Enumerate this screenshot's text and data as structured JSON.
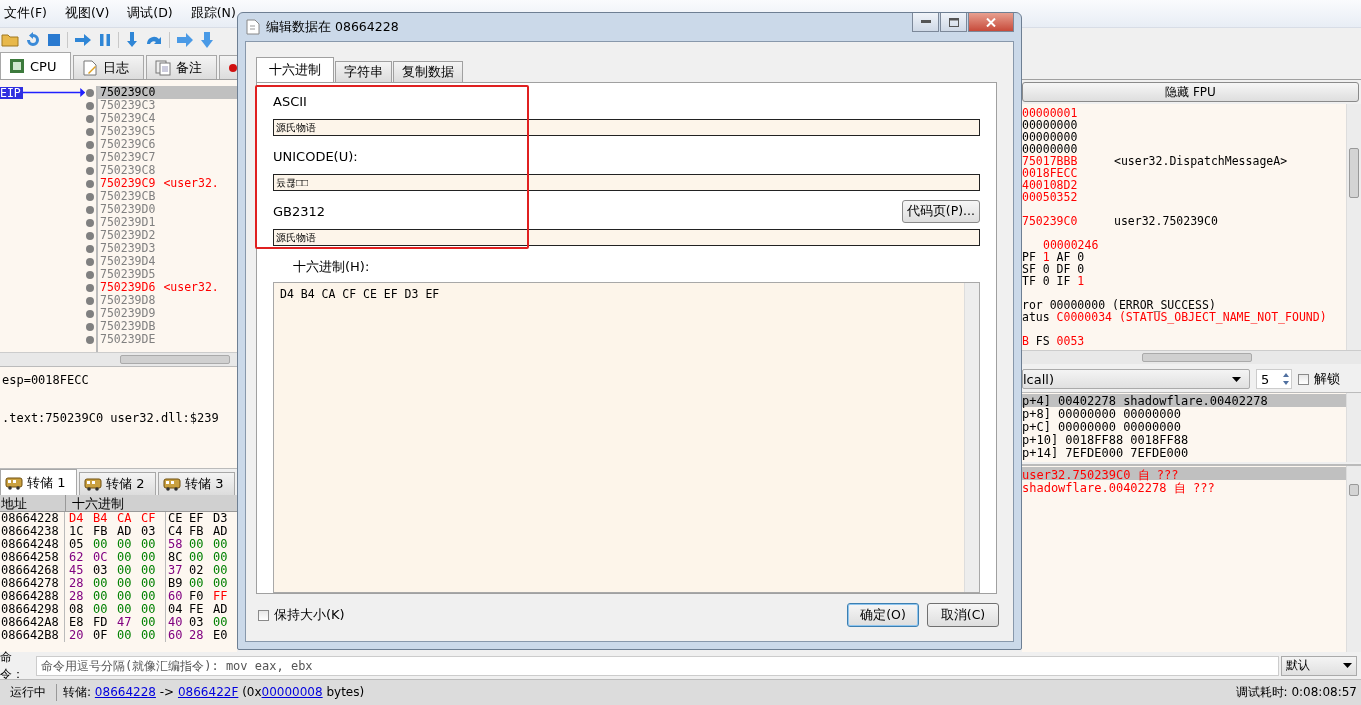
{
  "menu": [
    "文件(F)",
    "视图(V)",
    "调试(D)",
    "跟踪(N)"
  ],
  "main_tabs": [
    {
      "label": "CPU",
      "selected": true
    },
    {
      "label": "日志",
      "selected": false
    },
    {
      "label": "备注",
      "selected": false
    },
    {
      "selected": false
    }
  ],
  "disassembly": {
    "eip_label": "EIP",
    "rows": [
      {
        "address": "750239C0",
        "kind": "plain",
        "selected": true
      },
      {
        "address": "750239C3",
        "kind": "plain",
        "selected": false
      },
      {
        "address": "750239C4",
        "kind": "plain",
        "selected": false
      },
      {
        "address": "750239C5",
        "kind": "plain",
        "selected": false
      },
      {
        "address": "750239C6",
        "kind": "plain",
        "selected": false
      },
      {
        "address": "750239C7",
        "kind": "plain",
        "selected": false
      },
      {
        "address": "750239C8",
        "kind": "plain",
        "selected": false
      },
      {
        "address": "750239C9",
        "comment": "<user32.",
        "kind": "reference",
        "selected": false
      },
      {
        "address": "750239CB",
        "kind": "plain",
        "selected": false
      },
      {
        "address": "750239D0",
        "kind": "plain",
        "selected": false
      },
      {
        "address": "750239D1",
        "kind": "plain",
        "selected": false
      },
      {
        "address": "750239D2",
        "kind": "plain",
        "selected": false
      },
      {
        "address": "750239D3",
        "kind": "plain",
        "selected": false
      },
      {
        "address": "750239D4",
        "kind": "plain",
        "selected": false
      },
      {
        "address": "750239D5",
        "kind": "plain",
        "selected": false
      },
      {
        "address": "750239D6",
        "comment": "<user32.",
        "kind": "reference",
        "selected": false
      },
      {
        "address": "750239D8",
        "kind": "plain",
        "selected": false
      },
      {
        "address": "750239D9",
        "kind": "plain",
        "selected": false
      },
      {
        "address": "750239DB",
        "kind": "plain",
        "selected": false
      },
      {
        "address": "750239DE",
        "kind": "plain",
        "selected": false
      }
    ]
  },
  "info": [
    "esp=0018FECC",
    ".text:750239C0 user32.dll:$239"
  ],
  "dump_tabs": [
    {
      "label": "转储 1",
      "selected": true
    },
    {
      "label": "转储 2",
      "selected": false
    },
    {
      "label": "转储 3",
      "selected": false
    }
  ],
  "dump": {
    "columns": [
      "地址",
      "十六进制"
    ],
    "rows": [
      {
        "address": "08664228",
        "bytes": [
          {
            "text": "D4",
            "color": "#ff0000"
          },
          {
            "text": "B4",
            "color": "#ff0000"
          },
          {
            "text": "CA",
            "color": "#ff0000"
          },
          {
            "text": "CF",
            "color": "#ff0000"
          },
          {
            "text": "CE",
            "color": "#000000"
          },
          {
            "text": "EF",
            "color": "#000000"
          },
          {
            "text": "D3",
            "color": "#000000"
          }
        ]
      },
      {
        "address": "08664238",
        "bytes": [
          {
            "text": "1C",
            "color": "#000000"
          },
          {
            "text": "FB",
            "color": "#000000"
          },
          {
            "text": "AD",
            "color": "#000000"
          },
          {
            "text": "03",
            "color": "#000000"
          },
          {
            "text": "C4",
            "color": "#000000"
          },
          {
            "text": "FB",
            "color": "#000000"
          },
          {
            "text": "AD",
            "color": "#000000"
          }
        ]
      },
      {
        "address": "08664248",
        "bytes": [
          {
            "text": "05",
            "color": "#000000"
          },
          {
            "text": "00",
            "color": "#008000"
          },
          {
            "text": "00",
            "color": "#008000"
          },
          {
            "text": "00",
            "color": "#008000"
          },
          {
            "text": "58",
            "color": "#800080"
          },
          {
            "text": "00",
            "color": "#008000"
          },
          {
            "text": "00",
            "color": "#008000"
          }
        ]
      },
      {
        "address": "08664258",
        "bytes": [
          {
            "text": "62",
            "color": "#800080"
          },
          {
            "text": "0C",
            "color": "#800080"
          },
          {
            "text": "00",
            "color": "#008000"
          },
          {
            "text": "00",
            "color": "#008000"
          },
          {
            "text": "8C",
            "color": "#000000"
          },
          {
            "text": "00",
            "color": "#008000"
          },
          {
            "text": "00",
            "color": "#008000"
          }
        ]
      },
      {
        "address": "08664268",
        "bytes": [
          {
            "text": "45",
            "color": "#800080"
          },
          {
            "text": "03",
            "color": "#000000"
          },
          {
            "text": "00",
            "color": "#008000"
          },
          {
            "text": "00",
            "color": "#008000"
          },
          {
            "text": "37",
            "color": "#800080"
          },
          {
            "text": "02",
            "color": "#000000"
          },
          {
            "text": "00",
            "color": "#008000"
          }
        ]
      },
      {
        "address": "08664278",
        "bytes": [
          {
            "text": "28",
            "color": "#800080"
          },
          {
            "text": "00",
            "color": "#008000"
          },
          {
            "text": "00",
            "color": "#008000"
          },
          {
            "text": "00",
            "color": "#008000"
          },
          {
            "text": "B9",
            "color": "#000000"
          },
          {
            "text": "00",
            "color": "#008000"
          },
          {
            "text": "00",
            "color": "#008000"
          }
        ]
      },
      {
        "address": "08664288",
        "bytes": [
          {
            "text": "28",
            "color": "#800080"
          },
          {
            "text": "00",
            "color": "#008000"
          },
          {
            "text": "00",
            "color": "#008000"
          },
          {
            "text": "00",
            "color": "#008000"
          },
          {
            "text": "60",
            "color": "#800080"
          },
          {
            "text": "F0",
            "color": "#000000"
          },
          {
            "text": "FF",
            "color": "#ff0000"
          }
        ]
      },
      {
        "address": "08664298",
        "bytes": [
          {
            "text": "08",
            "color": "#000000"
          },
          {
            "text": "00",
            "color": "#008000"
          },
          {
            "text": "00",
            "color": "#008000"
          },
          {
            "text": "00",
            "color": "#008000"
          },
          {
            "text": "04",
            "color": "#000000"
          },
          {
            "text": "FE",
            "color": "#000000"
          },
          {
            "text": "AD",
            "color": "#000000"
          }
        ]
      },
      {
        "address": "086642A8",
        "bytes": [
          {
            "text": "E8",
            "color": "#000000"
          },
          {
            "text": "FD",
            "color": "#000000"
          },
          {
            "text": "47",
            "color": "#800080"
          },
          {
            "text": "00",
            "color": "#008000"
          },
          {
            "text": "40",
            "color": "#800080"
          },
          {
            "text": "03",
            "color": "#000000"
          },
          {
            "text": "00",
            "color": "#008000"
          }
        ]
      },
      {
        "address": "086642B8",
        "bytes": [
          {
            "text": "20",
            "color": "#800080"
          },
          {
            "text": "0F",
            "color": "#000000"
          },
          {
            "text": "00",
            "color": "#008000"
          },
          {
            "text": "00",
            "color": "#008000"
          },
          {
            "text": "60",
            "color": "#800080"
          },
          {
            "text": "28",
            "color": "#800080"
          },
          {
            "text": "E0",
            "color": "#000000"
          }
        ]
      }
    ]
  },
  "fpu_button": "隐藏 FPU",
  "registers": [
    [
      {
        "kind": "register",
        "segments": [
          {
            "text": "00000001",
            "changed": true
          }
        ]
      },
      {
        "kind": "register",
        "segments": [
          {
            "text": "00000000",
            "changed": false
          }
        ]
      },
      {
        "kind": "register",
        "segments": [
          {
            "text": "00000000",
            "changed": false
          }
        ]
      },
      {
        "kind": "register",
        "segments": [
          {
            "text": "00000000",
            "changed": false
          }
        ]
      },
      {
        "kind": "register",
        "segments": [
          {
            "text": "75017BBB",
            "changed": true
          },
          {
            "text": "<user32.DispatchMessageA>",
            "changed": false
          }
        ]
      },
      {
        "kind": "register",
        "segments": [
          {
            "text": "0018FECC",
            "changed": true
          }
        ]
      },
      {
        "kind": "register",
        "segments": [
          {
            "text": "400108D2",
            "changed": true
          }
        ]
      },
      {
        "kind": "register",
        "segments": [
          {
            "text": "00050352",
            "changed": true
          }
        ]
      }
    ],
    [
      {
        "kind": "register",
        "segments": [
          {
            "text": "750239C0",
            "changed": true
          },
          {
            "text": "user32.750239C0",
            "changed": false
          }
        ]
      }
    ],
    [
      {
        "kind": "indented",
        "segments": [
          {
            "text": "00000246",
            "changed": true
          }
        ]
      },
      {
        "kind": "flags",
        "segments": [
          {
            "text": "PF",
            "changed": false
          },
          {
            "text": "1",
            "changed": true
          },
          {
            "text": "AF",
            "changed": false
          },
          {
            "text": "0",
            "changed": false
          }
        ]
      },
      {
        "kind": "flags",
        "segments": [
          {
            "text": "SF",
            "changed": false
          },
          {
            "text": "0",
            "changed": false
          },
          {
            "text": "DF",
            "changed": false
          },
          {
            "text": "0",
            "changed": false
          }
        ]
      },
      {
        "kind": "flags",
        "segments": [
          {
            "text": "TF",
            "changed": false
          },
          {
            "text": "0",
            "changed": false
          },
          {
            "text": "IF",
            "changed": false
          },
          {
            "text": "1",
            "changed": true
          }
        ]
      }
    ],
    [
      {
        "kind": "flags",
        "segments": [
          {
            "text": "ror",
            "changed": false
          },
          {
            "text": "00000000",
            "changed": false
          },
          {
            "text": "(ERROR_SUCCESS)",
            "changed": false
          }
        ]
      },
      {
        "kind": "flags",
        "segments": [
          {
            "text": "atus",
            "changed": false
          },
          {
            "text": "C0000034",
            "changed": true
          },
          {
            "text": "(STATUS_OBJECT_NAME_NOT_FOUND)",
            "changed": true
          }
        ]
      }
    ],
    [
      {
        "kind": "flags",
        "segments": [
          {
            "text": "B",
            "changed": true
          },
          {
            "text": "FS",
            "changed": false
          },
          {
            "text": "0053",
            "changed": true
          }
        ]
      }
    ]
  ],
  "call_convention": {
    "value": "lcall)",
    "count": "5",
    "unlock": {
      "label": "解锁",
      "checked": false
    }
  },
  "stack_args": [
    {
      "text": "p+4] 00402278 shadowflare.00402278",
      "selected": true
    },
    {
      "text": "p+8] 00000000 00000000",
      "selected": false
    },
    {
      "text": "p+C] 00000000 00000000",
      "selected": false
    },
    {
      "text": "p+10] 0018FF88 0018FF88",
      "selected": false
    },
    {
      "text": "p+14] 7EFDE000 7EFDE000",
      "selected": false
    }
  ],
  "call_stack": [
    {
      "text": "user32.750239C0 自 ???",
      "selected": true
    },
    {
      "text": "shadowflare.00402278 自 ???",
      "selected": false
    }
  ],
  "command": {
    "label": "命令：",
    "placeholder": "命令用逗号分隔(就像汇编指令): mov eax, ebx",
    "mode": "默认"
  },
  "status": {
    "state": "运行中",
    "dump_prefix": "转储:",
    "start": "08664228",
    "arrow": "->",
    "end": "0866422F",
    "size_prefix": "(0x",
    "size": "00000008",
    "size_suffix": "bytes)",
    "timer": "调试耗时: 0:08:08:57"
  },
  "dialog": {
    "title": "编辑数据在 08664228",
    "tabs": [
      {
        "label": "十六进制",
        "selected": true
      },
      {
        "label": "字符串",
        "selected": false
      },
      {
        "label": "复制数据",
        "selected": false
      }
    ],
    "fields": [
      {
        "label": "ASCII",
        "value": "源氏物语"
      },
      {
        "label": "UNICODE(U):",
        "value": "듔쿊□□"
      },
      {
        "label": "GB2312",
        "value": "源氏物语",
        "button": "代码页(P)..."
      }
    ],
    "hex_label": "十六进制(H):",
    "hex_value": "D4 B4 CA CF CE EF D3 EF",
    "keep_size": {
      "label": "保持大小(K)",
      "checked": false
    },
    "buttons": [
      {
        "label": "确定(O)",
        "default": true
      },
      {
        "label": "取消(C)",
        "default": false
      }
    ]
  }
}
